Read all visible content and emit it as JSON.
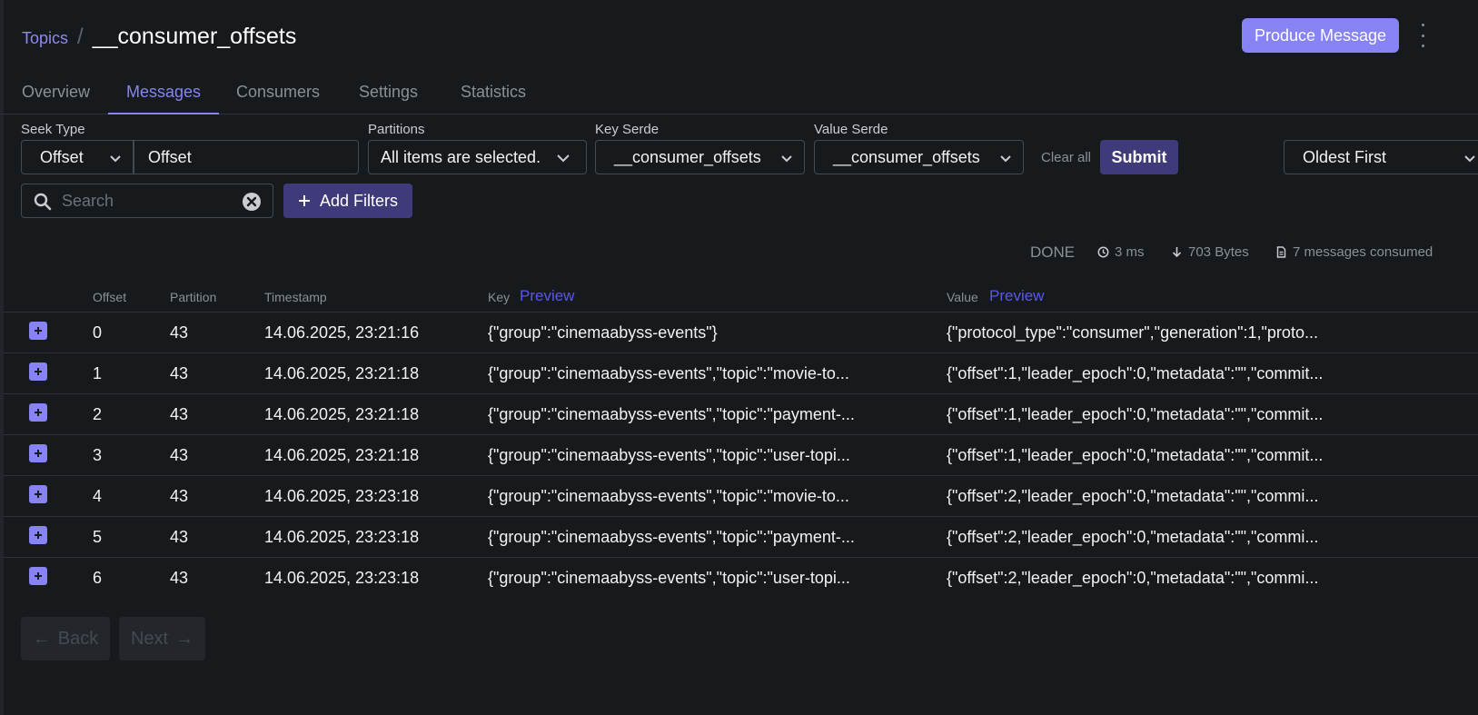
{
  "breadcrumb": {
    "parent": "Topics",
    "separator": "/",
    "title": "__consumer_offsets"
  },
  "header": {
    "produce_label": "Produce Message"
  },
  "tabs": [
    {
      "label": "Overview"
    },
    {
      "label": "Messages",
      "active": true
    },
    {
      "label": "Consumers"
    },
    {
      "label": "Settings"
    },
    {
      "label": "Statistics"
    }
  ],
  "filters": {
    "seek_type_label": "Seek Type",
    "seek_type_value": "Offset",
    "offset_value": "Offset",
    "partitions_label": "Partitions",
    "partitions_value": "All items are selected.",
    "key_serde_label": "Key Serde",
    "key_serde_value": "__consumer_offsets",
    "value_serde_label": "Value Serde",
    "value_serde_value": "__consumer_offsets",
    "clear_all": "Clear all",
    "submit": "Submit",
    "order_value": "Oldest First",
    "search_placeholder": "Search",
    "add_filters": "Add Filters"
  },
  "meta": {
    "status": "DONE",
    "time": "3 ms",
    "bytes": "703 Bytes",
    "messages": "7 messages consumed"
  },
  "table": {
    "headers": {
      "offset": "Offset",
      "partition": "Partition",
      "timestamp": "Timestamp",
      "key": "Key",
      "value": "Value",
      "preview": "Preview"
    },
    "rows": [
      {
        "offset": "0",
        "partition": "43",
        "timestamp": "14.06.2025, 23:21:16",
        "key": "{\"group\":\"cinemaabyss-events\"}",
        "value": "{\"protocol_type\":\"consumer\",\"generation\":1,\"proto..."
      },
      {
        "offset": "1",
        "partition": "43",
        "timestamp": "14.06.2025, 23:21:18",
        "key": "{\"group\":\"cinemaabyss-events\",\"topic\":\"movie-to...",
        "value": "{\"offset\":1,\"leader_epoch\":0,\"metadata\":\"\",\"commit..."
      },
      {
        "offset": "2",
        "partition": "43",
        "timestamp": "14.06.2025, 23:21:18",
        "key": "{\"group\":\"cinemaabyss-events\",\"topic\":\"payment-...",
        "value": "{\"offset\":1,\"leader_epoch\":0,\"metadata\":\"\",\"commit..."
      },
      {
        "offset": "3",
        "partition": "43",
        "timestamp": "14.06.2025, 23:21:18",
        "key": "{\"group\":\"cinemaabyss-events\",\"topic\":\"user-topi...",
        "value": "{\"offset\":1,\"leader_epoch\":0,\"metadata\":\"\",\"commit..."
      },
      {
        "offset": "4",
        "partition": "43",
        "timestamp": "14.06.2025, 23:23:18",
        "key": "{\"group\":\"cinemaabyss-events\",\"topic\":\"movie-to...",
        "value": "{\"offset\":2,\"leader_epoch\":0,\"metadata\":\"\",\"commi..."
      },
      {
        "offset": "5",
        "partition": "43",
        "timestamp": "14.06.2025, 23:23:18",
        "key": "{\"group\":\"cinemaabyss-events\",\"topic\":\"payment-...",
        "value": "{\"offset\":2,\"leader_epoch\":0,\"metadata\":\"\",\"commi..."
      },
      {
        "offset": "6",
        "partition": "43",
        "timestamp": "14.06.2025, 23:23:18",
        "key": "{\"group\":\"cinemaabyss-events\",\"topic\":\"user-topi...",
        "value": "{\"offset\":2,\"leader_epoch\":0,\"metadata\":\"\",\"commi..."
      }
    ]
  },
  "pagination": {
    "back": "Back",
    "next": "Next"
  },
  "colors": {
    "accent": "#8783f5",
    "accent_dark": "#3f3a7a",
    "background": "#171a1c",
    "link": "#5b57e8"
  }
}
